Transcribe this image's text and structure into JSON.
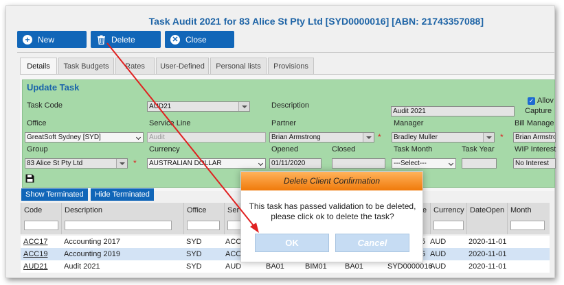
{
  "title": "Task Audit 2021 for 83 Alice St Pty Ltd [SYD0000016] [ABN: 21743357088]",
  "toolbar": {
    "new_label": "New",
    "delete_label": "Delete",
    "close_label": "Close"
  },
  "tabs": [
    {
      "label": "Details"
    },
    {
      "label": "Task Budgets"
    },
    {
      "label": "Rates"
    },
    {
      "label": "User-Defined"
    },
    {
      "label": "Personal lists"
    },
    {
      "label": "Provisions"
    }
  ],
  "form": {
    "heading": "Update Task",
    "labels": {
      "task_code": "Task Code",
      "description": "Description",
      "allow": "Allov",
      "capture": "Capture",
      "office": "Office",
      "service_line": "Service Line",
      "partner": "Partner",
      "manager": "Manager",
      "bill_manager": "Bill Manage",
      "group": "Group",
      "currency": "Currency",
      "opened": "Opened",
      "closed": "Closed",
      "task_month": "Task Month",
      "task_year": "Task Year",
      "wip_interest": "WIP Interest"
    },
    "values": {
      "task_code": "AUD21",
      "description": "Audit 2021",
      "office": "GreatSoft Sydney [SYD]",
      "service_line": "Audit",
      "partner": "Brian Armstrong",
      "manager": "Bradley Muller",
      "bill_manager": "Brian Armstro",
      "group": "83 Alice St Pty Ltd",
      "currency": "AUSTRALIAN DOLLAR",
      "opened": "01/11/2020",
      "closed": "",
      "task_month": "---Select---",
      "task_year": "",
      "wip_interest": "No Interest"
    },
    "required_mark": "*",
    "check_glyph": "✓"
  },
  "buttons": {
    "show_terminated": "Show Terminated",
    "hide_terminated": "Hide Terminated"
  },
  "grid": {
    "columns": [
      "Code",
      "Description",
      "Office",
      "Ser",
      "Currency",
      "DateOpen",
      "Month"
    ],
    "hidden_header_fragment": "e",
    "rows": [
      {
        "code": "ACC17",
        "description": "Accounting 2017",
        "office": "SYD",
        "ser": "ACC",
        "extra1": "",
        "extra2": "",
        "extra3": "",
        "client": "5",
        "currency": "AUD",
        "dateopen": "2020-11-01"
      },
      {
        "code": "ACC19",
        "description": "Accounting 2019",
        "office": "SYD",
        "ser": "ACC",
        "extra1": "",
        "extra2": "",
        "extra3": "",
        "client": "5",
        "currency": "AUD",
        "dateopen": "2020-11-01"
      },
      {
        "code": "AUD21",
        "description": "Audit 2021",
        "office": "SYD",
        "ser": "AUD",
        "extra1": "BA01",
        "extra2": "BIM01",
        "extra3": "BA01",
        "client": "SYD0000016",
        "currency": "AUD",
        "dateopen": "2020-11-01"
      }
    ]
  },
  "dialog": {
    "title": "Delete Client Confirmation",
    "message_line1": "This task has passed validation to be deleted,",
    "message_line2": "please click ok to delete the task?",
    "ok_label": "OK",
    "cancel_label": "Cancel"
  },
  "colors": {
    "primary": "#1166b8",
    "title": "#1e64a6",
    "form_bg": "#a6d9a8",
    "dialog_header": "#f07a0b",
    "annotation_arrow": "#e02020"
  }
}
